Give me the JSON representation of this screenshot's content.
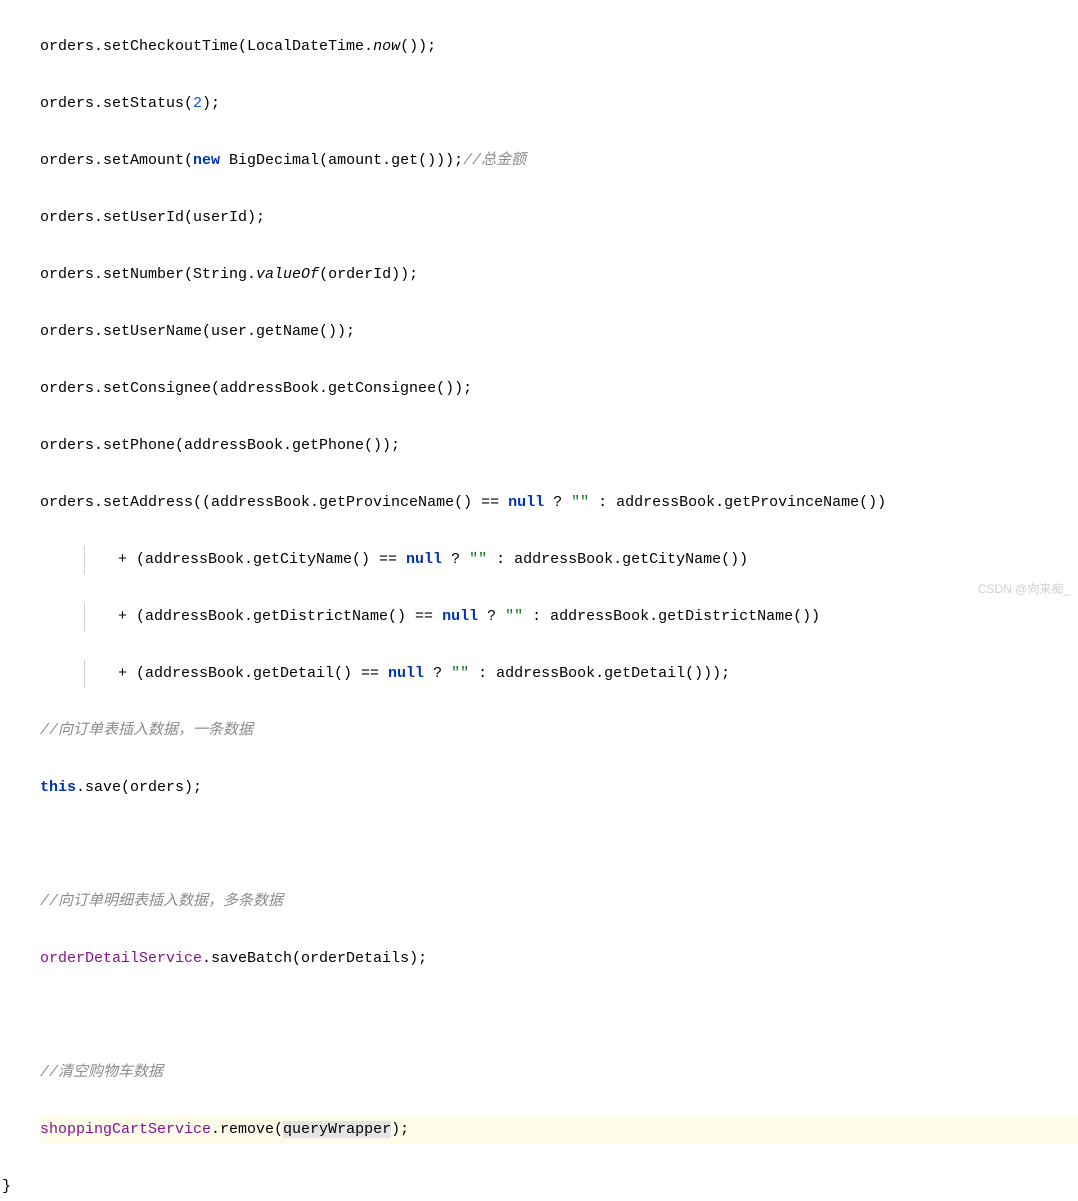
{
  "code": {
    "line1": {
      "prefix": "orders.setCheckoutTime(LocalDateTime.",
      "italic": "now",
      "suffix": "());"
    },
    "line2": {
      "prefix": "orders.setStatus(",
      "num": "2",
      "suffix": ");"
    },
    "line3": {
      "prefix": "orders.setAmount(",
      "kw_new": "new",
      "mid": " BigDecimal(amount.get()));",
      "comment": "//总金额"
    },
    "line4": "orders.setUserId(userId);",
    "line5": {
      "prefix": "orders.setNumber(String.",
      "italic": "valueOf",
      "suffix": "(orderId));"
    },
    "line6": "orders.setUserName(user.getName());",
    "line7": "orders.setConsignee(addressBook.getConsignee());",
    "line8": "orders.setPhone(addressBook.getPhone());",
    "line9": {
      "prefix": "orders.setAddress((addressBook.getProvinceName() == ",
      "kw_null": "null",
      "mid": " ? ",
      "str": "\"\"",
      "suffix": " : addressBook.getProvinceName())"
    },
    "line10": {
      "prefix": "+ (addressBook.getCityName() == ",
      "kw_null": "null",
      "mid": " ? ",
      "str": "\"\"",
      "suffix": " : addressBook.getCityName())"
    },
    "line11": {
      "prefix": "+ (addressBook.getDistrictName() == ",
      "kw_null": "null",
      "mid": " ? ",
      "str": "\"\"",
      "suffix": " : addressBook.getDistrictName())"
    },
    "line12": {
      "prefix": "+ (addressBook.getDetail() == ",
      "kw_null": "null",
      "mid": " ? ",
      "str": "\"\"",
      "suffix": " : addressBook.getDetail()));"
    },
    "line13_comment": "//向订单表插入数据，一条数据",
    "line14": {
      "kw_this": "this",
      "suffix": ".save(orders);"
    },
    "line15_comment": "//向订单明细表插入数据，多条数据",
    "line16": {
      "field": "orderDetailService",
      "suffix": ".saveBatch(orderDetails);"
    },
    "line17_comment": "//清空购物车数据",
    "line18": {
      "field": "shoppingCartService",
      "mid": ".remove(",
      "arg_pre": "queryW",
      "arg_post": "rapper",
      "suffix": ");"
    },
    "brace": "}"
  },
  "watermark": "CSDN @向来痴_"
}
